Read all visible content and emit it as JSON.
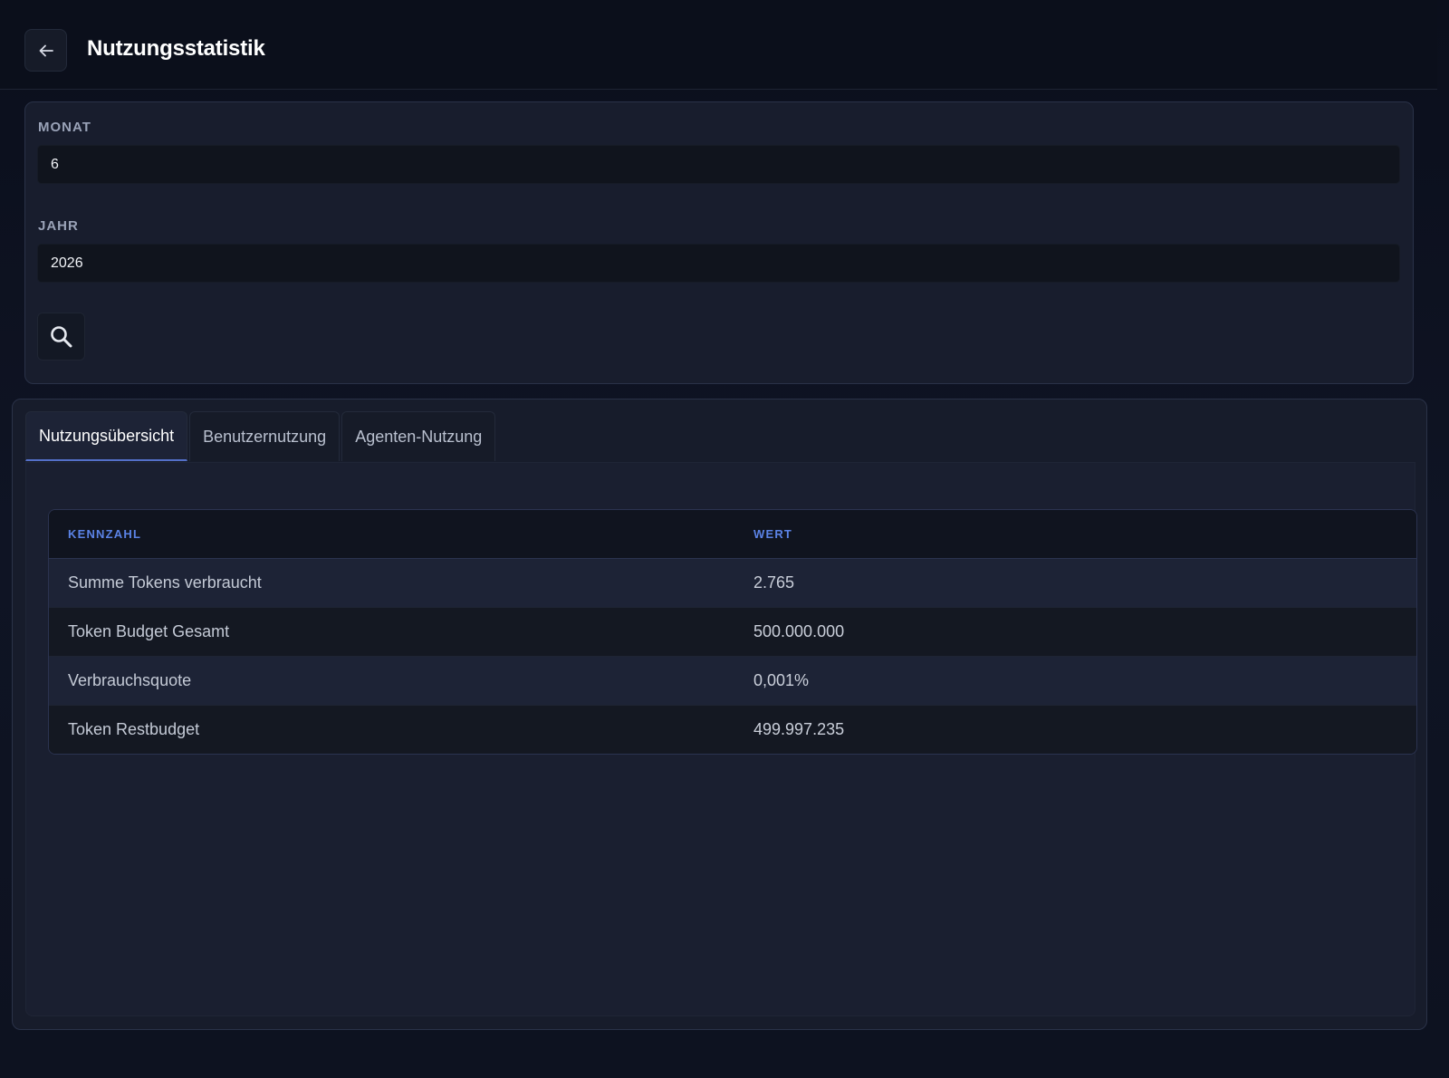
{
  "header": {
    "title": "Nutzungsstatistik",
    "back_icon": "arrow-left-icon"
  },
  "filters": {
    "month_label": "MONAT",
    "month_value": "6",
    "year_label": "JAHR",
    "year_value": "2026",
    "search_icon": "search-icon"
  },
  "tabs": [
    {
      "label": "Nutzungsübersicht",
      "active": true
    },
    {
      "label": "Benutzernutzung",
      "active": false
    },
    {
      "label": "Agenten-Nutzung",
      "active": false
    }
  ],
  "table": {
    "headers": [
      "KENNZAHL",
      "WERT"
    ],
    "rows": [
      {
        "metric": "Summe Tokens verbraucht",
        "value": "2.765"
      },
      {
        "metric": "Token Budget Gesamt",
        "value": "500.000.000"
      },
      {
        "metric": "Verbrauchsquote",
        "value": "0,001%"
      },
      {
        "metric": "Token Restbudget",
        "value": "499.997.235"
      }
    ]
  },
  "colors": {
    "accent": "#5b83e6",
    "background": "#0b0f1c",
    "card": "#181d2d"
  }
}
